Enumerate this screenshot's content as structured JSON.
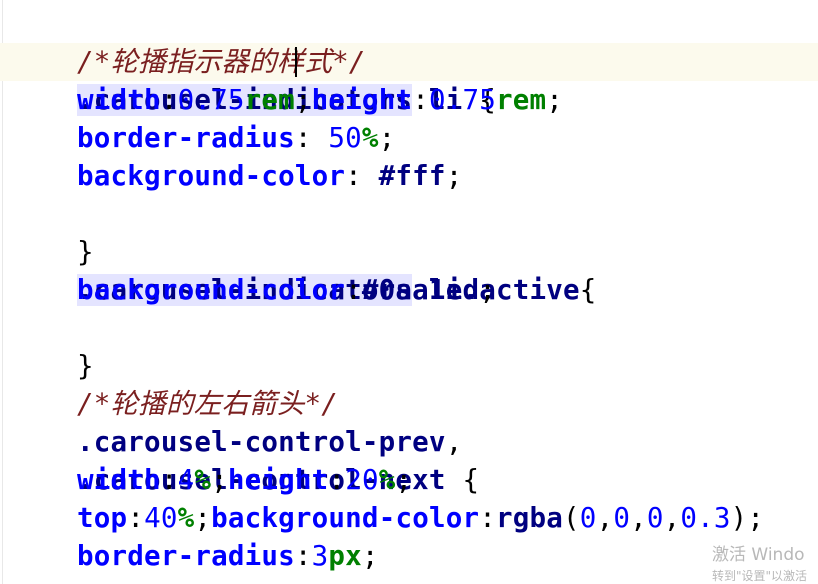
{
  "editor": {
    "lines": [
      {
        "comment": "/*轮播指示器的样式*/"
      },
      {
        "selector_a": ".carousel-indica",
        "selector_b": "tors",
        "selector_rest": " li",
        "brace": " {"
      },
      {
        "p1": "width",
        "v1n": "0.75",
        "v1u": "rem",
        "p2": "height",
        "v2n": "0.75",
        "v2u": "rem"
      },
      {
        "prop": "border-radius",
        "num": "50",
        "unit": "%"
      },
      {
        "prop": "background-color",
        "val": "#fff"
      },
      {
        "brace": "}"
      },
      {
        "selector": ".carousel-indicators",
        "selector_rest": " li.active",
        "brace": "{"
      },
      {
        "prop": "background-color",
        "val": "#0aa1ed"
      },
      {
        "brace": "}"
      },
      {
        "comment": "/*轮播的左右箭头*/"
      },
      {
        "selector": ".carousel-control-prev",
        "punct": ","
      },
      {
        "selector": ".carousel-control-next",
        "brace": " {"
      },
      {
        "p1": "width",
        "v1n": "4",
        "v1u": "%",
        "p2": "height",
        "v2n": "20",
        "v2u": "%"
      },
      {
        "p1": "top",
        "v1n": "40",
        "v1u": "%",
        "p2": "background-color",
        "fn": "rgba",
        "args": [
          "0",
          "0",
          "0",
          "0.3"
        ]
      },
      {
        "prop": "border-radius",
        "num": "3",
        "unit": "px"
      }
    ]
  },
  "watermark": {
    "title": "激活 Windo",
    "subtitle": "转到\"设置\"以激活"
  }
}
